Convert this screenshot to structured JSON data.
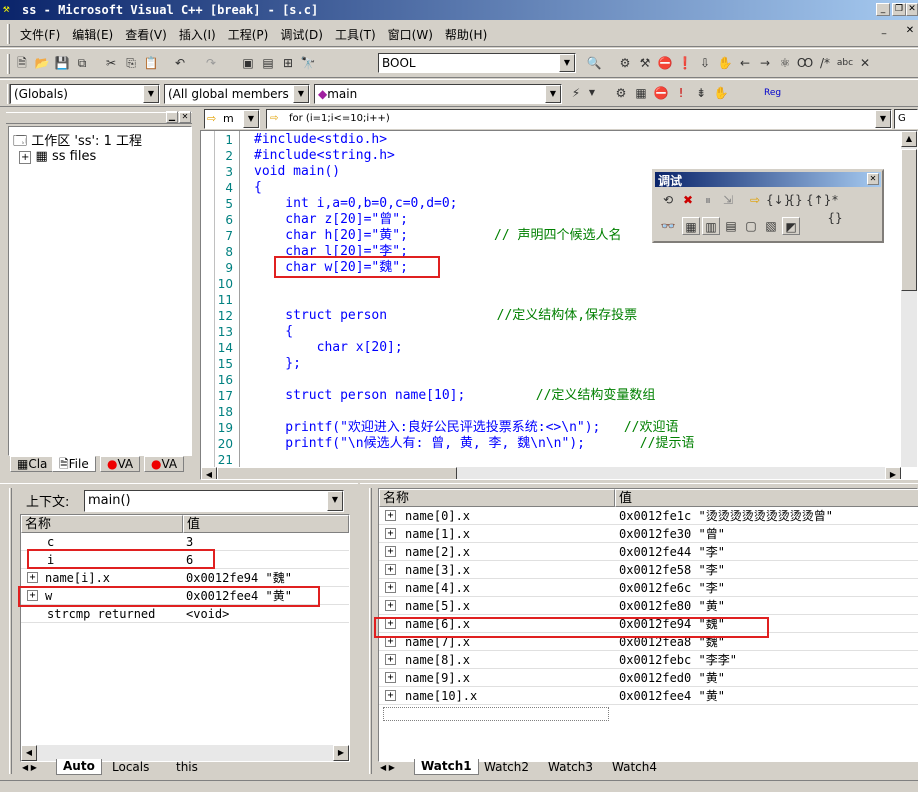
{
  "title": "ss - Microsoft Visual C++ [break] - [s.c]",
  "menu": [
    "文件(F)",
    "编辑(E)",
    "查看(V)",
    "插入(I)",
    "工程(P)",
    "调试(D)",
    "工具(T)",
    "窗口(W)",
    "帮助(H)"
  ],
  "toolbar": {
    "type_combo": "BOOL",
    "globals_combo": "(Globals)",
    "members_combo": "(All global members",
    "func_combo": "main",
    "reg_label": "Reg"
  },
  "workspace": {
    "root": "工作区 'ss': 1 工程",
    "files": "ss files",
    "tabs": [
      "Cla",
      "File",
      "VA",
      "VA"
    ]
  },
  "editor": {
    "combo_m": "m",
    "combo_for": "for (i=1;i<=10;i++)",
    "combo_right": "G",
    "line_numbers": [
      "1",
      "2",
      "3",
      "4",
      "5",
      "6",
      "7",
      "8",
      "9",
      "10",
      "11",
      "12",
      "13",
      "14",
      "15",
      "16",
      "17",
      "18",
      "19",
      "20",
      "21",
      "22"
    ],
    "lines": [
      [
        {
          "t": "#include<stdio.h>",
          "c": "kw"
        }
      ],
      [
        {
          "t": "#include<string.h>",
          "c": "kw"
        }
      ],
      [
        {
          "t": "void ",
          "c": "kw"
        },
        {
          "t": "main()",
          "c": "kw"
        }
      ],
      [
        {
          "t": "{",
          "c": "kw"
        }
      ],
      [
        {
          "t": "    int ",
          "c": "kw"
        },
        {
          "t": "i,a=0,b=0,c=0,d=0;",
          "c": "kw"
        }
      ],
      [
        {
          "t": "    char ",
          "c": "kw"
        },
        {
          "t": "z[20]=\"曾\";",
          "c": "kw"
        }
      ],
      [
        {
          "t": "    char ",
          "c": "kw"
        },
        {
          "t": "h[20]=\"黄\";",
          "c": "kw"
        },
        {
          "t": "           // 声明四个候选人名",
          "c": "cm"
        }
      ],
      [
        {
          "t": "    char ",
          "c": "kw"
        },
        {
          "t": "l[20]=\"李\";",
          "c": "kw"
        }
      ],
      [
        {
          "t": "    char ",
          "c": "kw"
        },
        {
          "t": "w[20]=\"魏\";",
          "c": "kw"
        }
      ],
      [
        {
          "t": "",
          "c": "kw"
        }
      ],
      [
        {
          "t": "",
          "c": "kw"
        }
      ],
      [
        {
          "t": "    struct ",
          "c": "kw"
        },
        {
          "t": "person",
          "c": "kw"
        },
        {
          "t": "              //定义结构体,保存投票",
          "c": "cm"
        }
      ],
      [
        {
          "t": "    {",
          "c": "kw"
        }
      ],
      [
        {
          "t": "        char ",
          "c": "kw"
        },
        {
          "t": "x[20];",
          "c": "kw"
        }
      ],
      [
        {
          "t": "    };",
          "c": "kw"
        }
      ],
      [
        {
          "t": "",
          "c": "kw"
        }
      ],
      [
        {
          "t": "    struct ",
          "c": "kw"
        },
        {
          "t": "person name[10];",
          "c": "kw"
        },
        {
          "t": "         //定义结构变量数组",
          "c": "cm"
        }
      ],
      [
        {
          "t": "",
          "c": "kw"
        }
      ],
      [
        {
          "t": "    printf",
          "c": "kw"
        },
        {
          "t": "(\"欢迎进入:良好公民评选投票系统:<>\\n\");",
          "c": "kw"
        },
        {
          "t": "   //欢迎语",
          "c": "cm"
        }
      ],
      [
        {
          "t": "    printf",
          "c": "kw"
        },
        {
          "t": "(\"\\n候选人有: 曾, 黄, 李, 魏\\n\\n\");",
          "c": "kw"
        },
        {
          "t": "       //提示语",
          "c": "cm"
        }
      ],
      [
        {
          "t": "",
          "c": "kw"
        }
      ],
      [
        {
          "t": "",
          "c": "kw"
        }
      ]
    ]
  },
  "debug_toolbar": {
    "title": "调试"
  },
  "variables": {
    "context_label": "上下文:",
    "context_value": "main()",
    "col_name": "名称",
    "col_value": "值",
    "rows": [
      {
        "name": "c",
        "value": "3",
        "expand": false
      },
      {
        "name": "i",
        "value": "6",
        "expand": false
      },
      {
        "name": "name[i].x",
        "value": "0x0012fe94 \"魏\"",
        "expand": true
      },
      {
        "name": "w",
        "value": "0x0012fee4 \"黄\"",
        "expand": true
      },
      {
        "name": "strcmp returned",
        "value": "<void>",
        "expand": false
      }
    ],
    "tabs": [
      "Auto",
      "Locals",
      "this"
    ]
  },
  "watch": {
    "col_name": "名称",
    "col_value": "值",
    "rows": [
      {
        "name": "name[0].x",
        "value": "0x0012fe1c \"烫烫烫烫烫烫烫烫烫曾\""
      },
      {
        "name": "name[1].x",
        "value": "0x0012fe30 \"曾\""
      },
      {
        "name": "name[2].x",
        "value": "0x0012fe44 \"李\""
      },
      {
        "name": "name[3].x",
        "value": "0x0012fe58 \"李\""
      },
      {
        "name": "name[4].x",
        "value": "0x0012fe6c \"李\""
      },
      {
        "name": "name[5].x",
        "value": "0x0012fe80 \"黄\""
      },
      {
        "name": "name[6].x",
        "value": "0x0012fe94 \"魏\""
      },
      {
        "name": "name[7].x",
        "value": "0x0012fea8 \"魏\""
      },
      {
        "name": "name[8].x",
        "value": "0x0012febc \"李李\""
      },
      {
        "name": "name[9].x",
        "value": "0x0012fed0 \"黄\""
      },
      {
        "name": "name[10].x",
        "value": "0x0012fee4 \"黄\""
      }
    ],
    "tabs": [
      "Watch1",
      "Watch2",
      "Watch3",
      "Watch4"
    ]
  }
}
